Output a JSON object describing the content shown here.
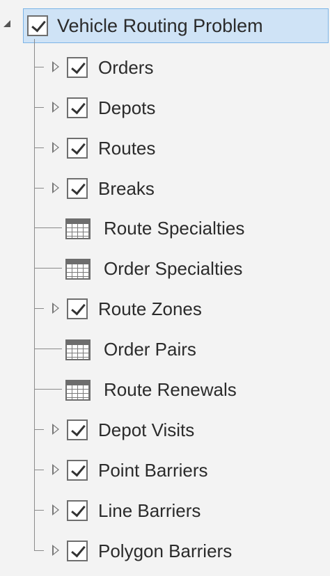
{
  "tree": {
    "root": {
      "label": "Vehicle Routing Problem",
      "checked": true,
      "expanded": true
    },
    "items": [
      {
        "label": "Orders",
        "kind": "layer",
        "checked": true,
        "expandable": true
      },
      {
        "label": "Depots",
        "kind": "layer",
        "checked": true,
        "expandable": true
      },
      {
        "label": "Routes",
        "kind": "layer",
        "checked": true,
        "expandable": true
      },
      {
        "label": "Breaks",
        "kind": "layer",
        "checked": true,
        "expandable": true
      },
      {
        "label": "Route Specialties",
        "kind": "table",
        "icon": "table-icon"
      },
      {
        "label": "Order Specialties",
        "kind": "table",
        "icon": "table-icon"
      },
      {
        "label": "Route Zones",
        "kind": "layer",
        "checked": true,
        "expandable": true
      },
      {
        "label": "Order Pairs",
        "kind": "table",
        "icon": "table-icon"
      },
      {
        "label": "Route Renewals",
        "kind": "table",
        "icon": "table-icon"
      },
      {
        "label": "Depot Visits",
        "kind": "layer",
        "checked": true,
        "expandable": true
      },
      {
        "label": "Point Barriers",
        "kind": "layer",
        "checked": true,
        "expandable": true
      },
      {
        "label": "Line Barriers",
        "kind": "layer",
        "checked": true,
        "expandable": true
      },
      {
        "label": "Polygon Barriers",
        "kind": "layer",
        "checked": true,
        "expandable": true
      }
    ]
  },
  "colors": {
    "background": "#f3f3f3",
    "selection": "#cfe3f6",
    "selection_border": "#7cb4e6",
    "text": "#2b2b2b"
  }
}
